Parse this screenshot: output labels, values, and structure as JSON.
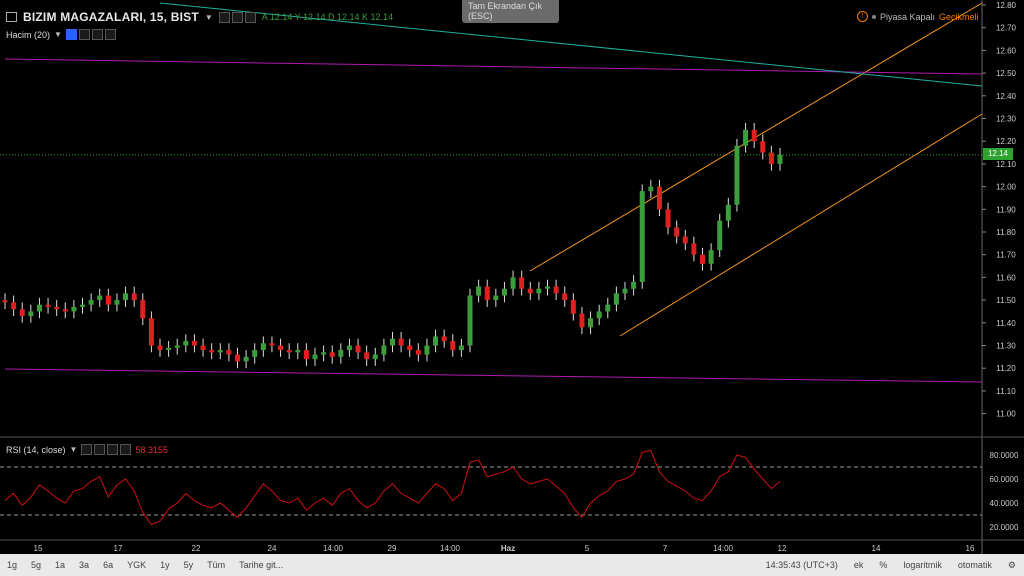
{
  "header": {
    "title": "BIZIM MAGAZALARI, 15, BIST",
    "ohlc": "A 12.14  Y 12.14  D 12.14  K 12.14",
    "volume_label": "Hacim (20)"
  },
  "rsi": {
    "label": "RSI (14, close)",
    "value": "58.3155"
  },
  "tooltip": {
    "line1": "Tam Ekrandan Çık",
    "line2": "(ESC)"
  },
  "status": {
    "market": "Piyasa Kapalı",
    "delay": "Gecikmeli"
  },
  "price_label": "12.14",
  "colors": {
    "up": "#3c9d3c",
    "down": "#e02020",
    "rsi": "#d01010",
    "channel": "#f5961e",
    "trend": "#b01ab0",
    "trend2": "#20b0a0"
  },
  "y_axis": [
    "12.80",
    "12.70",
    "12.60",
    "12.50",
    "12.40",
    "12.30",
    "12.20",
    "12.10",
    "12.00",
    "11.90",
    "11.80",
    "11.70",
    "11.60",
    "11.50",
    "11.40",
    "11.30",
    "11.20",
    "11.10",
    "11.00"
  ],
  "rsi_axis": [
    "80.0000",
    "60.0000",
    "40.0000",
    "20.0000"
  ],
  "x_axis": [
    "15",
    "17",
    "22",
    "24",
    "14:00",
    "29",
    "14:00",
    "Haz",
    "5",
    "7",
    "14:00",
    "12",
    "14",
    "16"
  ],
  "timeframes": [
    "1g",
    "5g",
    "1a",
    "3a",
    "6a",
    "YGK",
    "1y",
    "5y",
    "Tüm",
    "Tarihe git..."
  ],
  "bottom_right": {
    "time": "14:35:43 (UTC+3)",
    "ext": "ek",
    "pct": "%",
    "log": "logaritmik",
    "auto": "otomatik"
  },
  "chart_data": {
    "type": "candlestick",
    "ylim": [
      10.9,
      12.8
    ],
    "rsi_levels": [
      30,
      70
    ],
    "close": [
      11.49,
      11.46,
      11.43,
      11.45,
      11.48,
      11.47,
      11.46,
      11.45,
      11.47,
      11.48,
      11.5,
      11.52,
      11.48,
      11.5,
      11.53,
      11.5,
      11.42,
      11.3,
      11.28,
      11.29,
      11.3,
      11.32,
      11.3,
      11.28,
      11.27,
      11.28,
      11.26,
      11.23,
      11.25,
      11.28,
      11.31,
      11.3,
      11.28,
      11.27,
      11.28,
      11.24,
      11.26,
      11.27,
      11.25,
      11.28,
      11.3,
      11.27,
      11.24,
      11.26,
      11.3,
      11.33,
      11.3,
      11.28,
      11.26,
      11.3,
      11.34,
      11.32,
      11.28,
      11.3,
      11.52,
      11.56,
      11.5,
      11.52,
      11.55,
      11.6,
      11.55,
      11.53,
      11.55,
      11.56,
      11.53,
      11.5,
      11.44,
      11.38,
      11.42,
      11.45,
      11.48,
      11.53,
      11.55,
      11.58,
      11.98,
      12.0,
      11.9,
      11.82,
      11.78,
      11.75,
      11.7,
      11.66,
      11.72,
      11.85,
      11.92,
      12.18,
      12.25,
      12.2,
      12.15,
      12.1,
      12.14
    ],
    "rsi": [
      42,
      48,
      38,
      45,
      55,
      50,
      44,
      40,
      50,
      52,
      58,
      62,
      45,
      55,
      60,
      50,
      32,
      22,
      25,
      35,
      40,
      48,
      42,
      38,
      36,
      40,
      34,
      28,
      36,
      46,
      56,
      50,
      42,
      40,
      44,
      34,
      40,
      44,
      38,
      48,
      52,
      42,
      36,
      40,
      50,
      56,
      48,
      44,
      40,
      48,
      56,
      52,
      42,
      48,
      74,
      76,
      62,
      64,
      66,
      70,
      60,
      56,
      58,
      60,
      54,
      48,
      36,
      28,
      40,
      46,
      50,
      58,
      60,
      64,
      82,
      84,
      66,
      58,
      54,
      50,
      44,
      42,
      50,
      62,
      66,
      80,
      78,
      68,
      60,
      52,
      58
    ]
  },
  "drawings": {
    "channel": [
      [
        530,
        271,
        982,
        3
      ],
      [
        620,
        336,
        982,
        114
      ]
    ],
    "trend": [
      [
        5,
        59,
        982,
        74
      ],
      [
        5,
        369,
        982,
        382
      ]
    ],
    "trend2": [
      [
        160,
        3,
        982,
        86
      ]
    ]
  }
}
